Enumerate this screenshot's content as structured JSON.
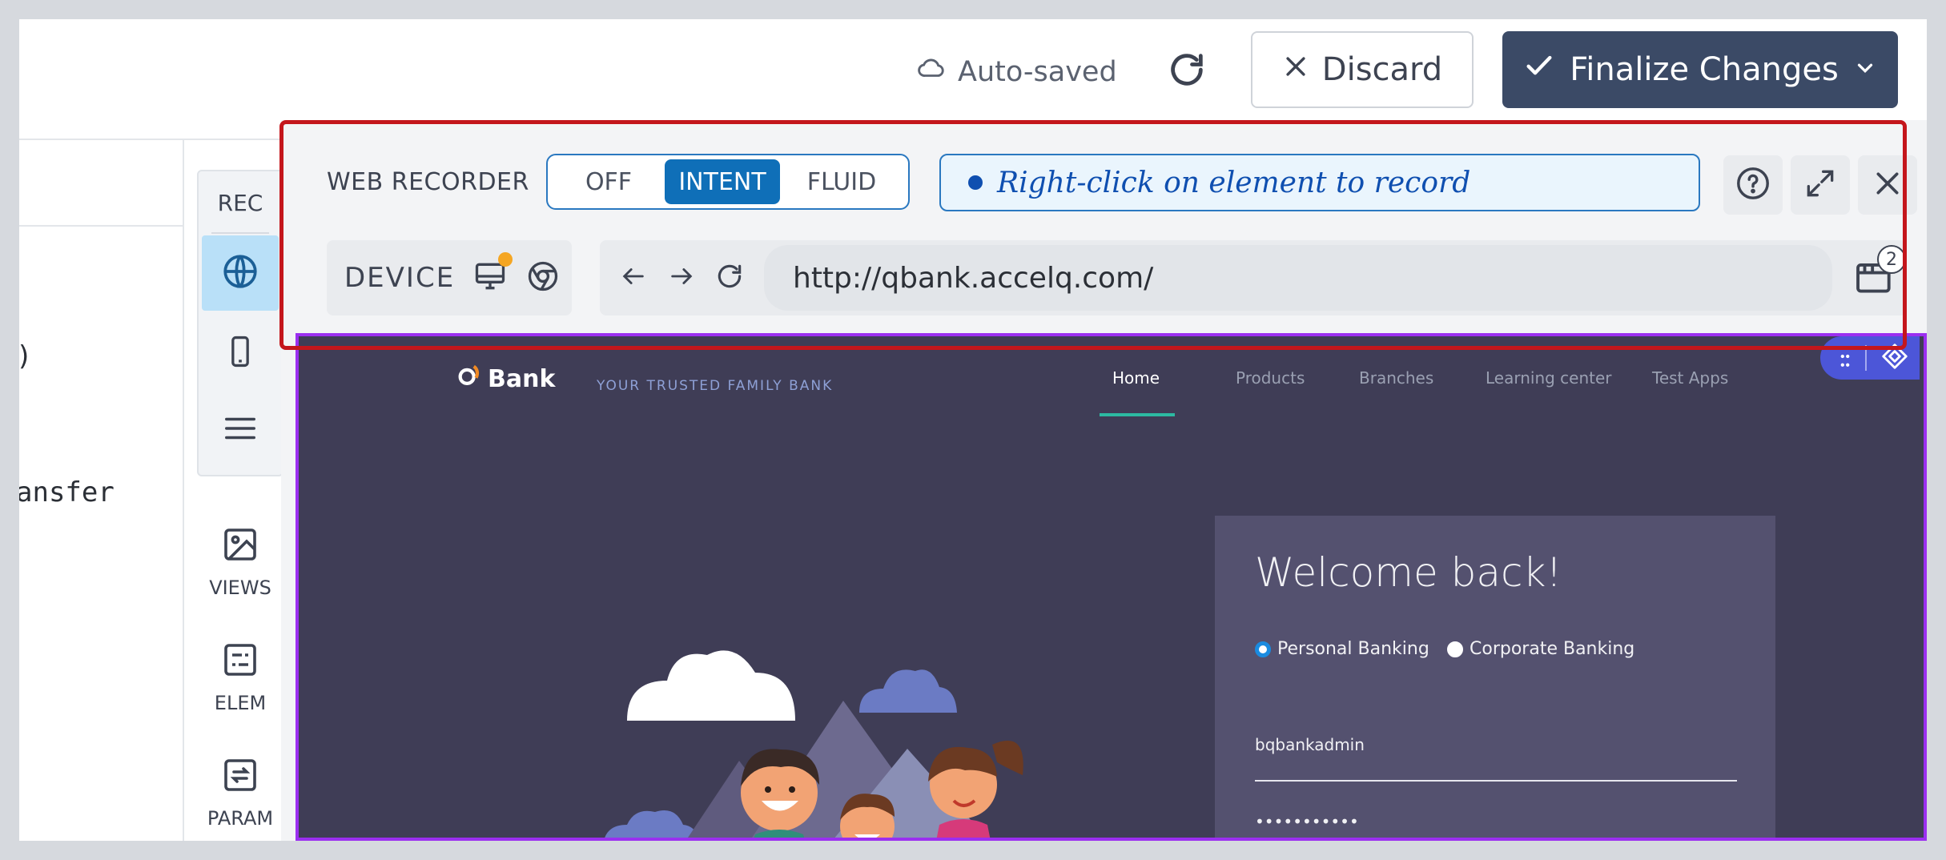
{
  "toolbar": {
    "autosaved_label": "Auto-saved",
    "discard_label": "Discard",
    "finalize_label": "Finalize Changes"
  },
  "code_lines": [
    ")",
    "ansfer"
  ],
  "rail": {
    "rec_label": "REC",
    "tools": [
      {
        "label": "VIEWS",
        "icon": "image-icon"
      },
      {
        "label": "ELEM",
        "icon": "element-icon"
      },
      {
        "label": "PARAM",
        "icon": "param-swap-icon"
      }
    ]
  },
  "recorder": {
    "title": "WEB RECORDER",
    "modes": [
      "OFF",
      "INTENT",
      "FLUID"
    ],
    "active_mode": "INTENT",
    "hint": "Right-click on element to record",
    "device_label": "DEVICE",
    "url": "http://qbank.accelq.com/",
    "tabs_count": "2"
  },
  "site": {
    "brand": "Bank",
    "tagline": "YOUR TRUSTED FAMILY BANK",
    "nav": [
      "Home",
      "Products",
      "Branches",
      "Learning center",
      "Test Apps"
    ],
    "active_nav": "Home",
    "login": {
      "heading": "Welcome back!",
      "options": [
        "Personal Banking",
        "Corporate Banking"
      ],
      "selected_option": "Personal Banking",
      "username": "bqbankadmin",
      "password_mask": "•••••••••••"
    }
  },
  "colors": {
    "primary": "#3b4a66",
    "accent": "#0f6fb8",
    "highlight": "#c4161c",
    "frame": "#9b2ff0",
    "site_bg": "#3f3d56"
  }
}
